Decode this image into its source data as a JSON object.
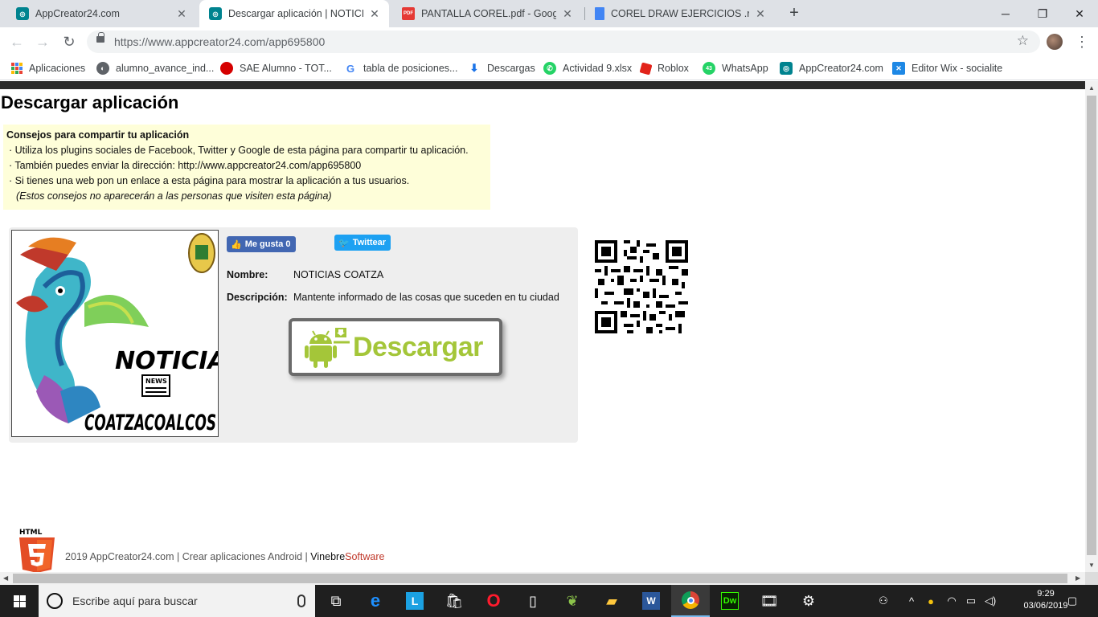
{
  "tabs": [
    {
      "title": "AppCreator24.com",
      "favicon": "appcreator-icon",
      "active": false
    },
    {
      "title": "Descargar aplicación | NOTICIAS",
      "favicon": "appcreator-icon",
      "active": true
    },
    {
      "title": "PANTALLA COREL.pdf - Google D",
      "favicon": "pdf-icon",
      "active": false
    },
    {
      "title": "COREL DRAW EJERCICIOS .rar - G",
      "favicon": "google-docs-icon",
      "active": false
    }
  ],
  "address_bar": {
    "url_host": "https://www.appcreator24.com",
    "url_path": "/app695800"
  },
  "bookmarks": [
    {
      "label": "Aplicaciones"
    },
    {
      "label": "alumno_avance_ind..."
    },
    {
      "label": "SAE Alumno - TOT..."
    },
    {
      "label": "tabla de posiciones..."
    },
    {
      "label": "Descargas"
    },
    {
      "label": "Actividad 9.xlsx"
    },
    {
      "label": "Roblox"
    },
    {
      "label": "WhatsApp",
      "badge": "43"
    },
    {
      "label": "AppCreator24.com"
    },
    {
      "label": "Editor Wix - socialite"
    }
  ],
  "page": {
    "title": "Descargar aplicación",
    "tips": {
      "heading": "Consejos para compartir tu aplicación",
      "items": [
        "· Utiliza los plugins sociales de Facebook, Twitter y Google de esta página para compartir tu aplicación.",
        "· También puedes enviar la dirección: http://www.appcreator24.com/app695800",
        "· Si tienes una web pon un enlace a esta página para mostrar la aplicación a tus usuarios."
      ],
      "note": "(Estos consejos no aparecerán a las personas que visiten esta página)"
    },
    "app": {
      "image_text_top": "NOTICIAS",
      "image_text_badge": "NEWS",
      "image_text_bottom": "COATZACOALCOS",
      "fb_like": "Me gusta 0",
      "tweet": "Twittear",
      "name_label": "Nombre:",
      "name_value": "NOTICIAS COATZA",
      "desc_label": "Descripción:",
      "desc_value": "Mantente informado de las cosas que suceden en tu ciudad",
      "download_label": "Descargar"
    },
    "footer": {
      "text": "2019 AppCreator24.com | Crear aplicaciones Android | ",
      "brand1": "Vinebre",
      "brand2": "Software",
      "logo_text": "HTML"
    }
  },
  "taskbar": {
    "search_placeholder": "Escribe aquí para buscar",
    "time": "9:29",
    "date": "03/06/2019"
  },
  "colors": {
    "android_green": "#a4c639",
    "facebook": "#4267b2",
    "twitter": "#1da1f2",
    "tips_bg": "#fefed9"
  }
}
